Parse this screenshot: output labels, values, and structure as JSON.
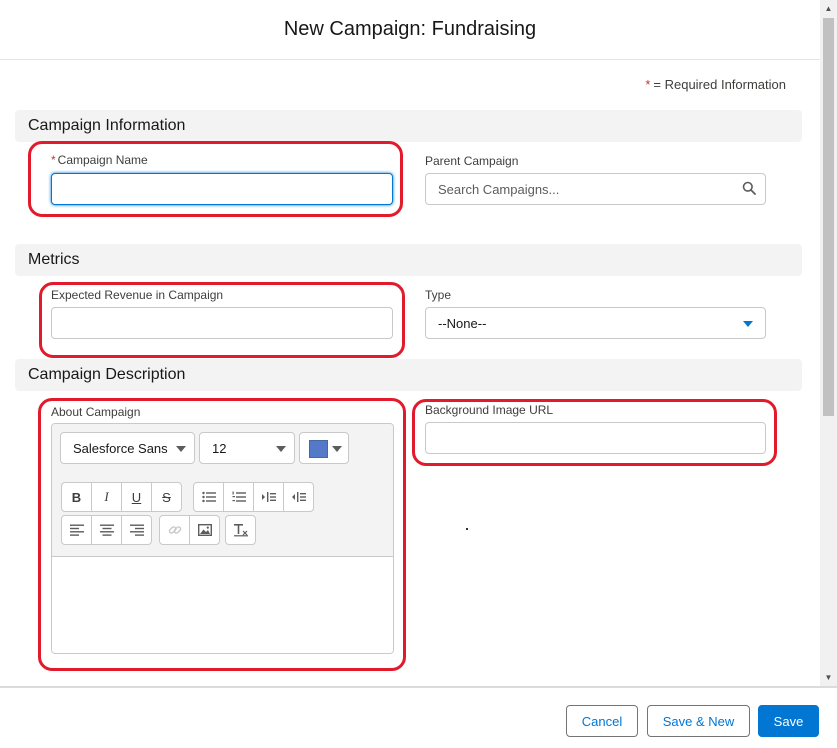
{
  "modal": {
    "title": "New Campaign: Fundraising"
  },
  "required_info": {
    "star": "*",
    "text": "= Required Information"
  },
  "sections": {
    "campaign_information": "Campaign Information",
    "metrics": "Metrics",
    "campaign_description": "Campaign Description"
  },
  "fields": {
    "campaign_name": {
      "required_star": "*",
      "label": "Campaign Name",
      "value": ""
    },
    "parent_campaign": {
      "label": "Parent Campaign",
      "placeholder": "Search Campaigns..."
    },
    "expected_revenue": {
      "label": "Expected Revenue in Campaign",
      "value": ""
    },
    "type": {
      "label": "Type",
      "selected": "--None--"
    },
    "about_campaign": {
      "label": "About Campaign"
    },
    "background_image_url": {
      "label": "Background Image URL",
      "value": ""
    }
  },
  "rte_toolbar": {
    "font_family": "Salesforce Sans",
    "font_size": "12",
    "text_color": "#5479c8",
    "format_buttons": [
      {
        "name": "bold-button",
        "icon": "B"
      },
      {
        "name": "italic-button",
        "icon": "I"
      },
      {
        "name": "underline-button",
        "icon": "U"
      },
      {
        "name": "strikethrough-button",
        "icon": "S"
      }
    ],
    "list_buttons": [
      "bulleted-list-icon",
      "numbered-list-icon",
      "indent-icon",
      "outdent-icon"
    ],
    "align_buttons": [
      "align-left-icon",
      "align-center-icon",
      "align-right-icon"
    ],
    "insert_buttons": [
      "link-icon",
      "image-icon"
    ],
    "clear_button": "clear-formatting-icon"
  },
  "footer": {
    "cancel": "Cancel",
    "save_new": "Save & New",
    "save": "Save"
  },
  "colors": {
    "brand": "#0176d3",
    "highlight": "#e21b2c",
    "section_bg": "#f3f3f3",
    "required": "#c23934"
  }
}
